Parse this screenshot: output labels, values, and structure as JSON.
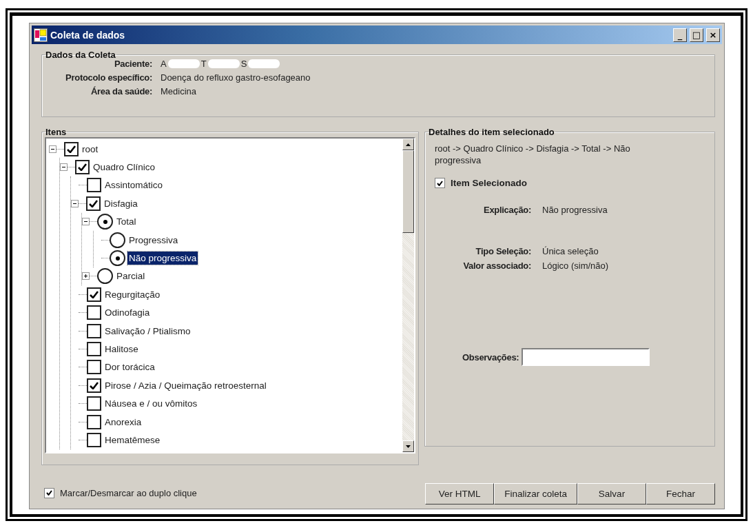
{
  "window": {
    "title": "Coleta de dados",
    "controls": [
      "_",
      "□",
      "×"
    ]
  },
  "dados_da_coleta": {
    "title": "Dados da Coleta",
    "fields": [
      {
        "label": "Paciente:",
        "value_parts": [
          "A",
          "T",
          "S"
        ],
        "redacted": true
      },
      {
        "label": "Protocolo específico:",
        "value": "Doença do refluxo gastro-esofageano"
      },
      {
        "label": "Área da saúde:",
        "value": "Medicina"
      }
    ]
  },
  "itens": {
    "title": "Itens",
    "tree": [
      {
        "label": "root",
        "kind": "checkbox",
        "checked": true,
        "expanded": true,
        "selected": false,
        "children": [
          {
            "label": "Quadro Clínico",
            "kind": "checkbox",
            "checked": true,
            "expanded": true,
            "selected": false,
            "children": [
              {
                "label": "Assintomático",
                "kind": "checkbox",
                "checked": false,
                "selected": false
              },
              {
                "label": "Disfagia",
                "kind": "checkbox",
                "checked": true,
                "expanded": true,
                "selected": false,
                "children": [
                  {
                    "label": "Total",
                    "kind": "radio",
                    "checked": true,
                    "expanded": true,
                    "selected": false,
                    "children": [
                      {
                        "label": "Progressiva",
                        "kind": "radio",
                        "checked": false,
                        "selected": false
                      },
                      {
                        "label": "Não progressiva",
                        "kind": "radio",
                        "checked": true,
                        "selected": true
                      }
                    ]
                  },
                  {
                    "label": "Parcial",
                    "kind": "radio",
                    "checked": false,
                    "expanded": false,
                    "selected": false
                  }
                ]
              },
              {
                "label": "Regurgitação",
                "kind": "checkbox",
                "checked": true,
                "selected": false
              },
              {
                "label": "Odinofagia",
                "kind": "checkbox",
                "checked": false,
                "selected": false
              },
              {
                "label": "Salivação / Ptialismo",
                "kind": "checkbox",
                "checked": false,
                "selected": false
              },
              {
                "label": "Halitose",
                "kind": "checkbox",
                "checked": false,
                "selected": false
              },
              {
                "label": "Dor torácica",
                "kind": "checkbox",
                "checked": false,
                "selected": false
              },
              {
                "label": "Pirose / Azia / Queimação retroesternal",
                "kind": "checkbox",
                "checked": true,
                "selected": false
              },
              {
                "label": "Náusea e / ou vômitos",
                "kind": "checkbox",
                "checked": false,
                "selected": false
              },
              {
                "label": "Anorexia",
                "kind": "checkbox",
                "checked": false,
                "selected": false
              },
              {
                "label": "Hematêmese",
                "kind": "checkbox",
                "checked": false,
                "selected": false
              }
            ]
          }
        ]
      }
    ]
  },
  "detalhes": {
    "title": "Detalhes do item selecionado",
    "path": "root -> Quadro Clínico -> Disfagia -> Total -> Não progressiva",
    "item_selecionado": {
      "label": "Item Selecionado",
      "checked": true
    },
    "explanation": {
      "label": "Explicação:",
      "value": "Não progressiva"
    },
    "properties": [
      {
        "label": "Tipo Seleção:",
        "value": "Única seleção"
      },
      {
        "label": "Valor associado:",
        "value": "Lógico (sim/não)"
      }
    ],
    "observacoes": {
      "label": "Observações:"
    }
  },
  "double_click_toggle": {
    "label": "Marcar/Desmarcar ao duplo clique",
    "checked": true
  },
  "buttons": [
    "Ver HTML",
    "Finalizar coleta",
    "Salvar",
    "Fechar"
  ]
}
